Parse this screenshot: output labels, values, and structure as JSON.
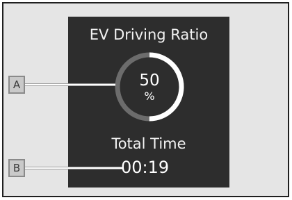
{
  "display": {
    "title": "EV Driving Ratio",
    "ratio": {
      "value": "50",
      "unit": "%",
      "fill_fraction": 0.5
    },
    "total_time": {
      "label": "Total Time",
      "value": "00:19"
    }
  },
  "callouts": [
    {
      "letter": "A"
    },
    {
      "letter": "B"
    }
  ],
  "colors": {
    "background": "#e5e5e5",
    "panel": "#2d2d2d",
    "ring_track": "#6c6c6c",
    "ring_fill": "#ffffff",
    "text": "#ffffff"
  }
}
